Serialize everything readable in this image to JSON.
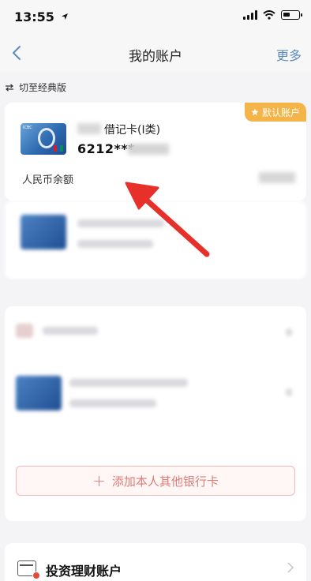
{
  "status_bar": {
    "time": "13:55",
    "battery_level": 0.45
  },
  "nav": {
    "title": "我的账户",
    "more": "更多"
  },
  "switch": {
    "label": "切至经典版"
  },
  "default_card": {
    "badge": "默认账户",
    "name": "借记卡(Ⅰ类)",
    "number": "6212***",
    "balance_label": "人民币余额"
  },
  "add_card": {
    "plus": "+",
    "label": "添加本人其他银行卡"
  },
  "invest": {
    "label": "投资理财账户"
  }
}
